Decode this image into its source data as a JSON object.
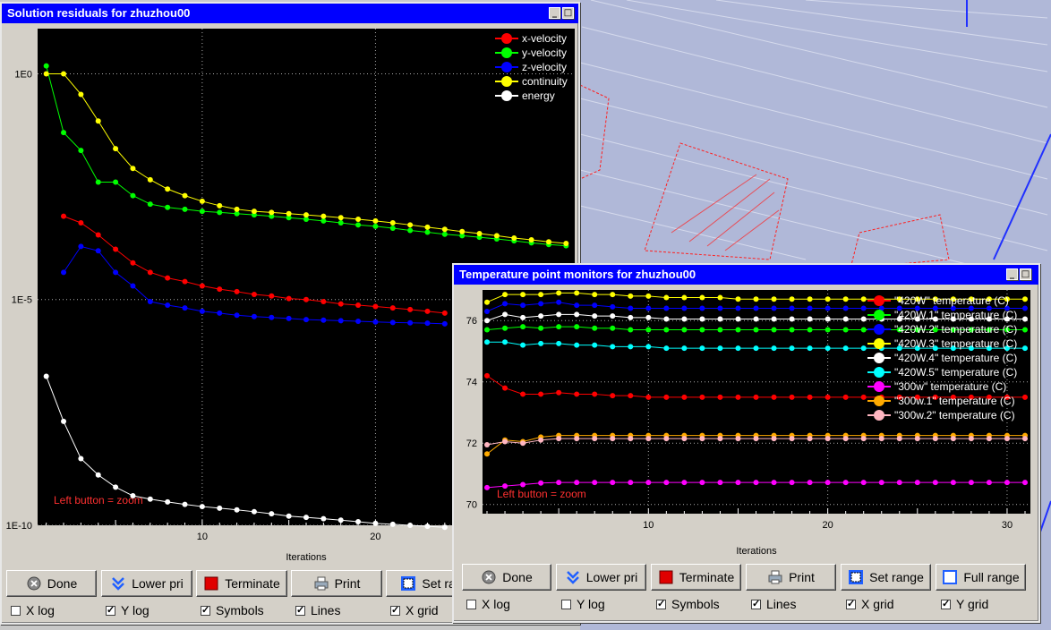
{
  "colors": {
    "red": "#ff0000",
    "green": "#00ff00",
    "blue": "#0000ff",
    "yellow": "#ffff00",
    "white": "#ffffff",
    "cyan": "#00ffff",
    "magenta": "#ff00ff",
    "orange": "#ffaa00",
    "pink": "#ffb6c1"
  },
  "residuals": {
    "title": "Solution residuals for zhuzhou00",
    "legend": [
      "x-velocity",
      "y-velocity",
      "z-velocity",
      "continuity",
      "energy"
    ],
    "yticks": [
      "1E0",
      "1E-5",
      "1E-10"
    ],
    "xticks": [
      "10",
      "20"
    ],
    "xlabel": "Iterations",
    "hint": "Left button = zoom",
    "buttons": {
      "done": "Done",
      "lower": "Lower pri",
      "terminate": "Terminate",
      "print": "Print",
      "setrange": "Set ran"
    },
    "checks": {
      "xlog": "X log",
      "ylog": "Y log",
      "symbols": "Symbols",
      "lines": "Lines",
      "xgrid": "X grid"
    }
  },
  "temps": {
    "title": "Temperature point monitors for zhuzhou00",
    "legend": [
      "\"420W\" temperature (C)",
      "\"420W.1\" temperature (C)",
      "\"420W.2\" temperature (C)",
      "\"420W.3\" temperature (C)",
      "\"420W.4\" temperature (C)",
      "\"420W.5\" temperature (C)",
      "\"300w\" temperature (C)",
      "\"300w.1\" temperature (C)",
      "\"300w.2\" temperature (C)"
    ],
    "yticks": [
      "76",
      "74",
      "72",
      "70"
    ],
    "xticks": [
      "10",
      "20",
      "30"
    ],
    "xlabel": "Iterations",
    "hint": "Left button = zoom",
    "buttons": {
      "done": "Done",
      "lower": "Lower pri",
      "terminate": "Terminate",
      "print": "Print",
      "setrange": "Set range",
      "fullrange": "Full range"
    },
    "checks": {
      "xlog": "X log",
      "ylog": "Y log",
      "symbols": "Symbols",
      "lines": "Lines",
      "xgrid": "X grid",
      "ygrid": "Y grid"
    }
  },
  "chart_data": [
    {
      "type": "line",
      "title": "Solution residuals for zhuzhou00",
      "xlabel": "Iterations",
      "ylabel": "",
      "yscale": "log",
      "ylim": [
        1e-10,
        10
      ],
      "series": [
        {
          "name": "x-velocity",
          "color": "#ff0000",
          "x": [
            2,
            3,
            4,
            5,
            6,
            7,
            8,
            9,
            10,
            11,
            12,
            13,
            14,
            15,
            16,
            17,
            18,
            19,
            20,
            21,
            22,
            23,
            24
          ],
          "y": [
            0.0007,
            0.0005,
            0.00027,
            0.00013,
            6.5e-05,
            4e-05,
            3e-05,
            2.5e-05,
            2e-05,
            1.7e-05,
            1.5e-05,
            1.3e-05,
            1.2e-05,
            1.05e-05,
            1e-05,
            9e-06,
            8e-06,
            7.5e-06,
            7e-06,
            6.5e-06,
            6e-06,
            5.5e-06,
            5e-06
          ]
        },
        {
          "name": "y-velocity",
          "color": "#00ff00",
          "x": [
            1,
            2,
            3,
            4,
            5,
            6,
            7,
            8,
            9,
            10,
            11,
            12,
            13,
            14,
            15,
            16,
            17,
            18,
            19,
            20,
            21,
            22,
            23,
            24,
            25,
            26,
            27,
            28,
            29,
            30,
            31
          ],
          "y": [
            1.5,
            0.05,
            0.02,
            0.004,
            0.004,
            0.002,
            0.0013,
            0.0011,
            0.001,
            0.0009,
            0.00085,
            0.0008,
            0.00075,
            0.0007,
            0.00065,
            0.0006,
            0.00055,
            0.0005,
            0.00045,
            0.00042,
            0.00038,
            0.00034,
            0.00031,
            0.00028,
            0.00026,
            0.00024,
            0.00022,
            0.0002,
            0.00018,
            0.000165,
            0.000155
          ]
        },
        {
          "name": "z-velocity",
          "color": "#0000ff",
          "x": [
            2,
            3,
            4,
            5,
            6,
            7,
            8,
            9,
            10,
            11,
            12,
            13,
            14,
            15,
            16,
            17,
            18,
            19,
            20,
            21,
            22,
            23,
            24
          ],
          "y": [
            4e-05,
            0.00015,
            0.00012,
            4e-05,
            2e-05,
            9e-06,
            7.5e-06,
            6.5e-06,
            5.5e-06,
            5e-06,
            4.5e-06,
            4.2e-06,
            4e-06,
            3.8e-06,
            3.6e-06,
            3.5e-06,
            3.4e-06,
            3.3e-06,
            3.2e-06,
            3.1e-06,
            3.05e-06,
            3e-06,
            2.9e-06
          ]
        },
        {
          "name": "continuity",
          "color": "#ffff00",
          "x": [
            1,
            2,
            3,
            4,
            5,
            6,
            7,
            8,
            9,
            10,
            11,
            12,
            13,
            14,
            15,
            16,
            17,
            18,
            19,
            20,
            21,
            22,
            23,
            24,
            25,
            26,
            27,
            28,
            29,
            30,
            31
          ],
          "y": [
            1,
            1,
            0.35,
            0.09,
            0.022,
            0.008,
            0.0045,
            0.0028,
            0.002,
            0.0015,
            0.0012,
            0.001,
            0.0009,
            0.00085,
            0.0008,
            0.00075,
            0.0007,
            0.00065,
            0.0006,
            0.00055,
            0.0005,
            0.00045,
            0.0004,
            0.00036,
            0.00032,
            0.00029,
            0.00026,
            0.00023,
            0.00021,
            0.00019,
            0.000175
          ]
        },
        {
          "name": "energy",
          "color": "#ffffff",
          "x": [
            1,
            2,
            3,
            4,
            5,
            6,
            7,
            8,
            9,
            10,
            11,
            12,
            13,
            14,
            15,
            16,
            17,
            18,
            19,
            20,
            21,
            22,
            23,
            24
          ],
          "y": [
            2e-07,
            2e-08,
            3e-09,
            1.3e-09,
            7e-10,
            4.5e-10,
            3.8e-10,
            3.3e-10,
            2.9e-10,
            2.6e-10,
            2.4e-10,
            2.2e-10,
            2e-10,
            1.8e-10,
            1.6e-10,
            1.5e-10,
            1.4e-10,
            1.3e-10,
            1.2e-10,
            1.1e-10,
            1.05e-10,
            1e-10,
            9.5e-11,
            9e-11
          ]
        }
      ]
    },
    {
      "type": "line",
      "title": "Temperature point monitors for zhuzhou00",
      "xlabel": "Iterations",
      "ylabel": "",
      "ylim": [
        69.7,
        77.0
      ],
      "series": [
        {
          "name": "\"420W\" temperature (C)",
          "color": "#ff0000",
          "x": [
            1,
            2,
            3,
            4,
            5,
            6,
            7,
            8,
            9,
            10,
            11,
            12,
            13,
            14,
            15,
            16,
            17,
            18,
            19,
            20,
            21,
            22,
            23,
            24,
            25,
            26,
            27,
            28,
            29,
            30,
            31
          ],
          "y": [
            74.2,
            73.8,
            73.6,
            73.6,
            73.65,
            73.6,
            73.6,
            73.55,
            73.55,
            73.5,
            73.5,
            73.5,
            73.5,
            73.5,
            73.5,
            73.5,
            73.5,
            73.5,
            73.5,
            73.5,
            73.5,
            73.5,
            73.5,
            73.5,
            73.5,
            73.5,
            73.5,
            73.5,
            73.5,
            73.5,
            73.5
          ]
        },
        {
          "name": "\"420W.1\" temperature (C)",
          "color": "#00ff00",
          "x": [
            1,
            2,
            3,
            4,
            5,
            6,
            7,
            8,
            9,
            10,
            11,
            12,
            13,
            14,
            15,
            16,
            17,
            18,
            19,
            20,
            21,
            22,
            23,
            24,
            25,
            26,
            27,
            28,
            29,
            30,
            31
          ],
          "y": [
            75.7,
            75.75,
            75.8,
            75.75,
            75.8,
            75.8,
            75.75,
            75.75,
            75.7,
            75.7,
            75.7,
            75.7,
            75.7,
            75.7,
            75.7,
            75.7,
            75.7,
            75.7,
            75.7,
            75.7,
            75.7,
            75.7,
            75.7,
            75.7,
            75.7,
            75.7,
            75.7,
            75.7,
            75.7,
            75.7,
            75.7
          ]
        },
        {
          "name": "\"420W.2\" temperature (C)",
          "color": "#0000ff",
          "x": [
            1,
            2,
            3,
            4,
            5,
            6,
            7,
            8,
            9,
            10,
            11,
            12,
            13,
            14,
            15,
            16,
            17,
            18,
            19,
            20,
            21,
            22,
            23,
            24,
            25,
            26,
            27,
            28,
            29,
            30,
            31
          ],
          "y": [
            76.3,
            76.55,
            76.5,
            76.55,
            76.6,
            76.5,
            76.5,
            76.45,
            76.4,
            76.4,
            76.4,
            76.4,
            76.4,
            76.4,
            76.4,
            76.4,
            76.4,
            76.4,
            76.4,
            76.4,
            76.4,
            76.4,
            76.4,
            76.4,
            76.4,
            76.4,
            76.4,
            76.4,
            76.4,
            76.4,
            76.4
          ]
        },
        {
          "name": "\"420W.3\" temperature (C)",
          "color": "#ffff00",
          "x": [
            1,
            2,
            3,
            4,
            5,
            6,
            7,
            8,
            9,
            10,
            11,
            12,
            13,
            14,
            15,
            16,
            17,
            18,
            19,
            20,
            21,
            22,
            23,
            24,
            25,
            26,
            27,
            28,
            29,
            30,
            31
          ],
          "y": [
            76.6,
            76.85,
            76.85,
            76.85,
            76.9,
            76.9,
            76.85,
            76.85,
            76.8,
            76.8,
            76.75,
            76.75,
            76.75,
            76.75,
            76.7,
            76.7,
            76.7,
            76.7,
            76.7,
            76.7,
            76.7,
            76.7,
            76.7,
            76.7,
            76.7,
            76.7,
            76.7,
            76.7,
            76.7,
            76.7,
            76.7
          ]
        },
        {
          "name": "\"420W.4\" temperature (C)",
          "color": "#ffffff",
          "x": [
            1,
            2,
            3,
            4,
            5,
            6,
            7,
            8,
            9,
            10,
            11,
            12,
            13,
            14,
            15,
            16,
            17,
            18,
            19,
            20,
            21,
            22,
            23,
            24,
            25,
            26,
            27,
            28,
            29,
            30,
            31
          ],
          "y": [
            76.0,
            76.2,
            76.1,
            76.15,
            76.2,
            76.2,
            76.15,
            76.15,
            76.1,
            76.1,
            76.05,
            76.05,
            76.05,
            76.05,
            76.05,
            76.05,
            76.05,
            76.05,
            76.05,
            76.05,
            76.05,
            76.05,
            76.05,
            76.05,
            76.05,
            76.05,
            76.05,
            76.05,
            76.05,
            76.05,
            76.05
          ]
        },
        {
          "name": "\"420W.5\" temperature (C)",
          "color": "#00ffff",
          "x": [
            1,
            2,
            3,
            4,
            5,
            6,
            7,
            8,
            9,
            10,
            11,
            12,
            13,
            14,
            15,
            16,
            17,
            18,
            19,
            20,
            21,
            22,
            23,
            24,
            25,
            26,
            27,
            28,
            29,
            30,
            31
          ],
          "y": [
            75.3,
            75.3,
            75.2,
            75.25,
            75.25,
            75.2,
            75.2,
            75.15,
            75.15,
            75.15,
            75.1,
            75.1,
            75.1,
            75.1,
            75.1,
            75.1,
            75.1,
            75.1,
            75.1,
            75.1,
            75.1,
            75.1,
            75.1,
            75.1,
            75.1,
            75.1,
            75.1,
            75.1,
            75.1,
            75.1,
            75.1
          ]
        },
        {
          "name": "\"300w\" temperature (C)",
          "color": "#ff00ff",
          "x": [
            1,
            2,
            3,
            4,
            5,
            6,
            7,
            8,
            9,
            10,
            11,
            12,
            13,
            14,
            15,
            16,
            17,
            18,
            19,
            20,
            21,
            22,
            23,
            24,
            25,
            26,
            27,
            28,
            29,
            30,
            31
          ],
          "y": [
            70.55,
            70.6,
            70.65,
            70.7,
            70.72,
            70.72,
            70.72,
            70.72,
            70.72,
            70.72,
            70.72,
            70.72,
            70.72,
            70.72,
            70.72,
            70.72,
            70.72,
            70.72,
            70.72,
            70.72,
            70.72,
            70.72,
            70.72,
            70.72,
            70.72,
            70.72,
            70.72,
            70.72,
            70.72,
            70.72,
            70.72
          ]
        },
        {
          "name": "\"300w.1\" temperature (C)",
          "color": "#ffaa00",
          "x": [
            1,
            2,
            3,
            4,
            5,
            6,
            7,
            8,
            9,
            10,
            11,
            12,
            13,
            14,
            15,
            16,
            17,
            18,
            19,
            20,
            21,
            22,
            23,
            24,
            25,
            26,
            27,
            28,
            29,
            30,
            31
          ],
          "y": [
            71.65,
            72.1,
            72.05,
            72.2,
            72.25,
            72.25,
            72.25,
            72.25,
            72.25,
            72.25,
            72.25,
            72.25,
            72.25,
            72.25,
            72.25,
            72.25,
            72.25,
            72.25,
            72.25,
            72.25,
            72.25,
            72.25,
            72.25,
            72.25,
            72.25,
            72.25,
            72.25,
            72.25,
            72.25,
            72.25,
            72.25
          ]
        },
        {
          "name": "\"300w.2\" temperature (C)",
          "color": "#ffb6c1",
          "x": [
            1,
            2,
            3,
            4,
            5,
            6,
            7,
            8,
            9,
            10,
            11,
            12,
            13,
            14,
            15,
            16,
            17,
            18,
            19,
            20,
            21,
            22,
            23,
            24,
            25,
            26,
            27,
            28,
            29,
            30,
            31
          ],
          "y": [
            71.95,
            72.05,
            72.0,
            72.1,
            72.15,
            72.15,
            72.15,
            72.15,
            72.15,
            72.15,
            72.15,
            72.15,
            72.15,
            72.15,
            72.15,
            72.15,
            72.15,
            72.15,
            72.15,
            72.15,
            72.15,
            72.15,
            72.15,
            72.15,
            72.15,
            72.15,
            72.15,
            72.15,
            72.15,
            72.15,
            72.15
          ]
        }
      ]
    }
  ]
}
